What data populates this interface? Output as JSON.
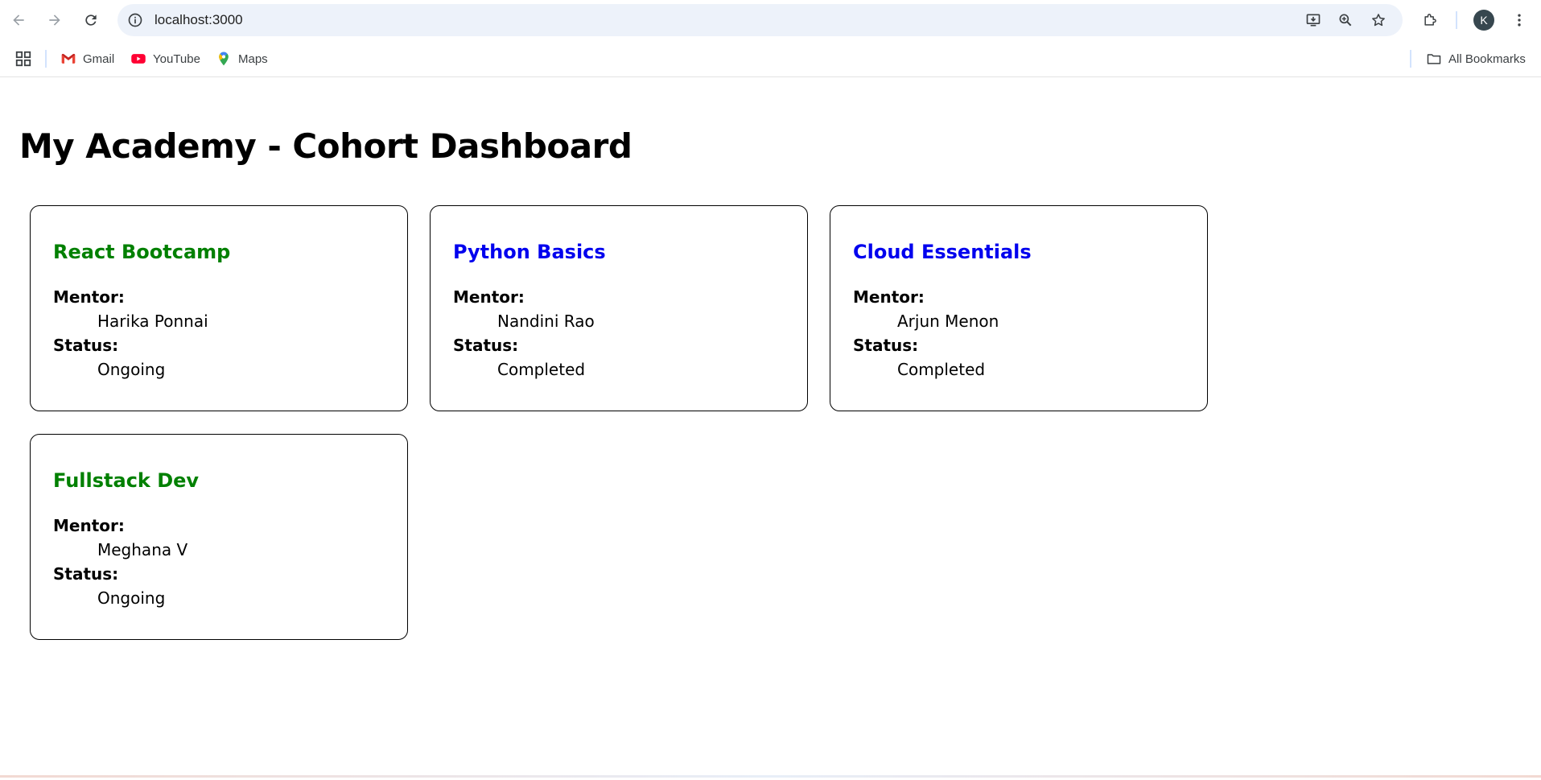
{
  "browser": {
    "url": "localhost:3000",
    "profile_initial": "K",
    "icons": {
      "back": "arrow-left-icon",
      "forward": "arrow-right-icon",
      "reload": "reload-icon",
      "site_info": "info-icon",
      "install": "install-app-icon",
      "zoom": "zoom-icon",
      "bookmark": "star-icon",
      "extensions": "puzzle-icon",
      "menu": "kebab-menu-icon"
    }
  },
  "bookmarks": {
    "items": [
      {
        "label": "Gmail",
        "icon": "gmail-icon"
      },
      {
        "label": "YouTube",
        "icon": "youtube-icon"
      },
      {
        "label": "Maps",
        "icon": "maps-icon"
      }
    ],
    "all_bookmarks_label": "All Bookmarks"
  },
  "page": {
    "title": "My Academy - Cohort Dashboard",
    "cohorts": [
      {
        "name": "React Bootcamp",
        "mentor_label": "Mentor:",
        "mentor": "Harika Ponnai",
        "status_label": "Status:",
        "status": "Ongoing",
        "title_color": "#008000"
      },
      {
        "name": "Python Basics",
        "mentor_label": "Mentor:",
        "mentor": "Nandini Rao",
        "status_label": "Status:",
        "status": "Completed",
        "title_color": "#0000ee"
      },
      {
        "name": "Cloud Essentials",
        "mentor_label": "Mentor:",
        "mentor": "Arjun Menon",
        "status_label": "Status:",
        "status": "Completed",
        "title_color": "#0000ee"
      },
      {
        "name": "Fullstack Dev",
        "mentor_label": "Mentor:",
        "mentor": "Meghana V",
        "status_label": "Status:",
        "status": "Ongoing",
        "title_color": "#008000"
      }
    ]
  }
}
